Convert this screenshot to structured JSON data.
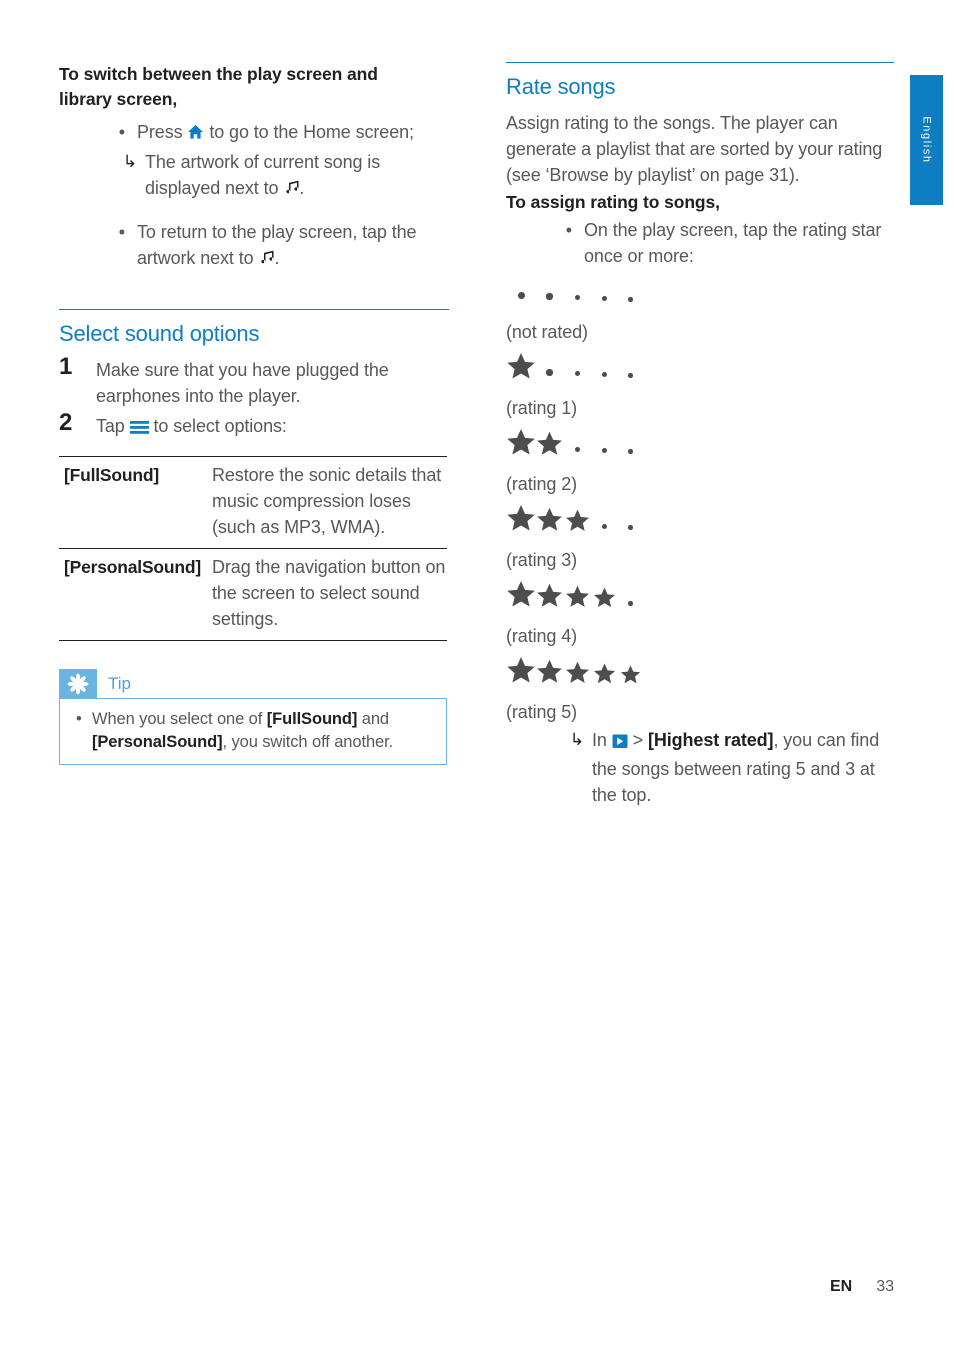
{
  "page": {
    "language_tab": "English",
    "footer_locale": "EN",
    "footer_page_number": "33",
    "accent_blue": "#0f7dc2",
    "tip_blue": "#6cb4e0",
    "body_gray": "#58585a"
  },
  "left_column": {
    "intro_heading_line1": "To switch between the play screen and",
    "intro_heading_line2": "library screen,",
    "intro_bullets": [
      {
        "marker": "•",
        "text_before_icon": "Press ",
        "icon": "home-icon",
        "text_after_icon": " to go to the Home screen;"
      },
      {
        "marker": "↳",
        "text_before_icon": "The artwork of current song is displayed next to ",
        "icon": "music-note-icon",
        "text_after_icon": "."
      },
      {
        "marker": "•",
        "text_before_icon": "To return to the play screen, tap the artwork next to ",
        "icon": "music-note-icon",
        "text_after_icon": "."
      }
    ],
    "section_title": "Select sound options",
    "steps": [
      {
        "number": "1",
        "text": "Make sure that you have plugged the earphones into the player."
      },
      {
        "number": "2",
        "text_before_icon": "Tap ",
        "icon": "hamburger-menu-icon",
        "text_after_icon": " to select options:"
      }
    ],
    "options_table": {
      "rows": [
        {
          "key": "[FullSound]",
          "value": "Restore the sonic details that music compression loses (such as MP3, WMA)."
        },
        {
          "key": "[PersonalSound]",
          "value": "Drag the navigation button on the screen to select sound settings."
        }
      ]
    },
    "tip": {
      "icon": "tip-asterisk-icon",
      "label": "Tip",
      "bullet_marker": "•",
      "text_part1": "When you select one of ",
      "bold1": "[FullSound]",
      "text_part2": " and ",
      "bold2": "[PersonalSound]",
      "text_part3": ", you switch off another."
    }
  },
  "right_column": {
    "section_title": "Rate songs",
    "intro_paragraph": "Assign rating to the songs. The player can generate a playlist that are sorted by your rating (see ‘Browse by playlist’ on page 31).",
    "subheading": "To assign rating to songs,",
    "bullet": {
      "marker": "•",
      "text": "On the play screen, tap the rating star once or more:"
    },
    "ratings": [
      {
        "stars": 0,
        "dots": 5,
        "caption": "(not rated)"
      },
      {
        "stars": 1,
        "dots": 4,
        "caption": "(rating 1)"
      },
      {
        "stars": 2,
        "dots": 3,
        "caption": "(rating 2)"
      },
      {
        "stars": 3,
        "dots": 2,
        "caption": "(rating 3)"
      },
      {
        "stars": 4,
        "dots": 1,
        "caption": "(rating 4)"
      },
      {
        "stars": 5,
        "dots": 0,
        "caption": "(rating 5)"
      }
    ],
    "note": {
      "marker": "↳",
      "text_before_icon": "In ",
      "icon": "playlist-icon",
      "text_separator": " > ",
      "bold": "[Highest rated]",
      "text_after": ", you can find the songs between rating 5 and 3 at the top."
    }
  }
}
